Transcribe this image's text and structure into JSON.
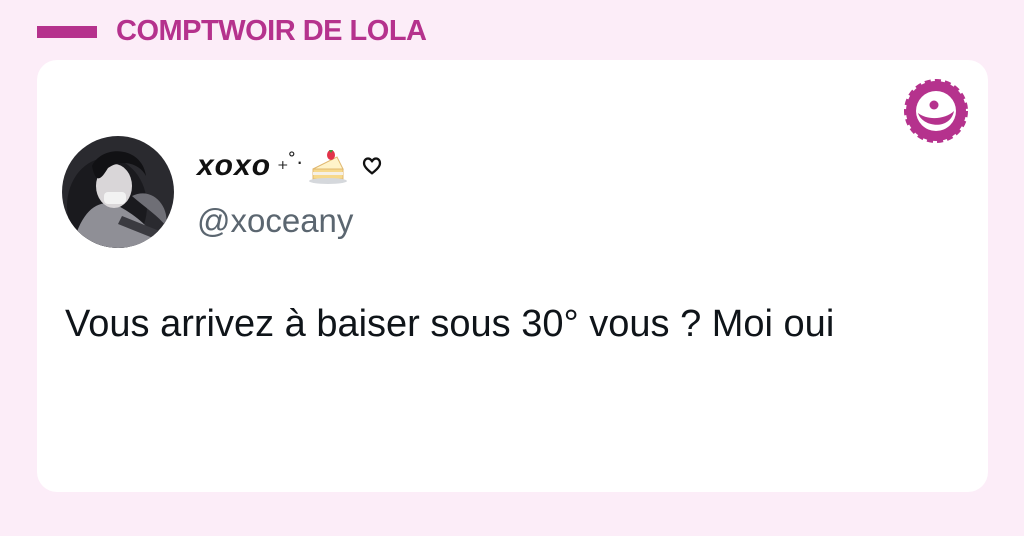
{
  "brand": {
    "name": "COMPTWOIR DE LOLA",
    "accent_color": "#b5328d"
  },
  "background_color": "#fcedf8",
  "tweet": {
    "display_name": "xoxo",
    "display_name_decoration": "₊˚·",
    "display_name_emojis": [
      "cake-icon",
      "heart-icon"
    ],
    "handle": "@xoceany",
    "text": "Vous arrivez à baiser sous 30° vous ? Moi oui",
    "avatar": "user-avatar-photo"
  }
}
